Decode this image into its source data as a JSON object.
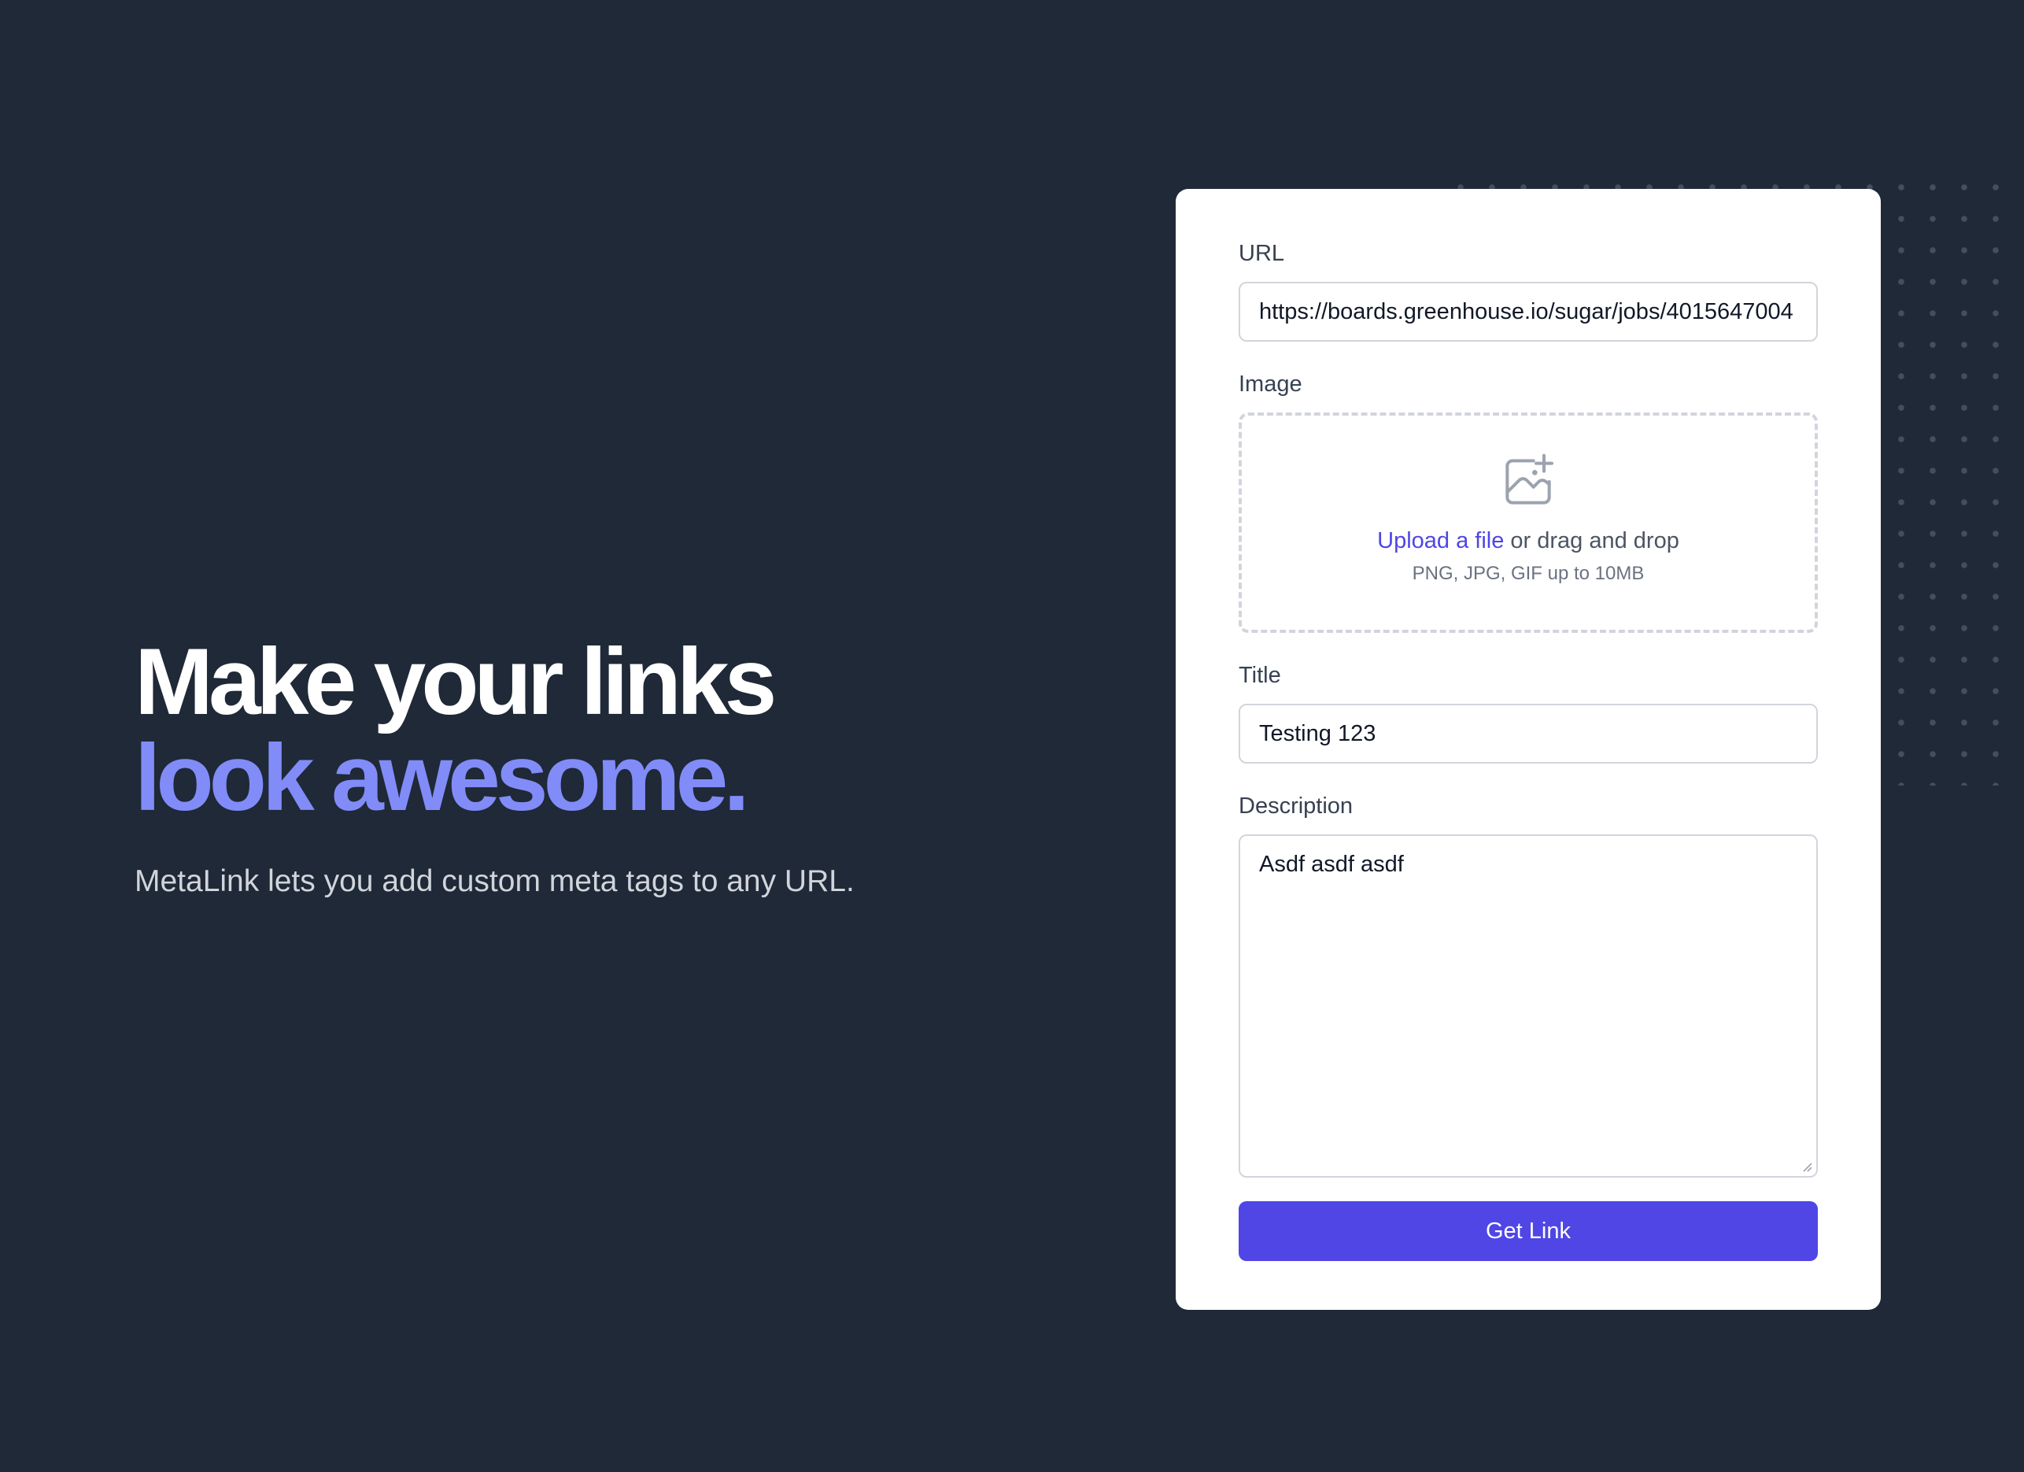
{
  "hero": {
    "headline_line1": "Make your links",
    "headline_line2": "look awesome.",
    "subtitle": "MetaLink lets you add custom meta tags to any URL."
  },
  "form": {
    "url": {
      "label": "URL",
      "value": "https://boards.greenhouse.io/sugar/jobs/4015647004"
    },
    "image": {
      "label": "Image",
      "icon": "image-plus-icon",
      "upload_link": "Upload a file",
      "upload_rest": " or drag and drop",
      "hint": "PNG, JPG, GIF up to 10MB"
    },
    "title": {
      "label": "Title",
      "value": "Testing 123"
    },
    "description": {
      "label": "Description",
      "value": "Asdf asdf asdf"
    },
    "submit_label": "Get Link"
  },
  "colors": {
    "background": "#1f2937",
    "accent": "#4f46e5",
    "headline_accent": "#818cf8"
  }
}
